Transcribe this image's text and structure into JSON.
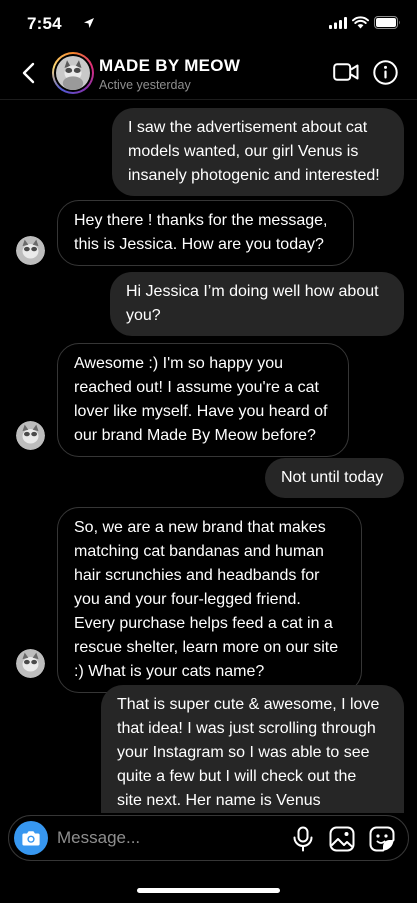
{
  "status_bar": {
    "time": "7:54"
  },
  "header": {
    "name": "MADE BY MEOW",
    "status": "Active yesterday"
  },
  "messages": [
    {
      "side": "sent",
      "lines": [
        "I saw the advertisement about cat",
        "models wanted, our girl Venus is",
        "insanely photogenic and interested!"
      ]
    },
    {
      "side": "received",
      "lines": [
        "Hey there ! thanks for the message,",
        "this is Jessica. How are you today?"
      ]
    },
    {
      "side": "sent",
      "lines": [
        "Hi Jessica I’m doing well how about",
        "you?"
      ]
    },
    {
      "side": "received",
      "lines": [
        "Awesome :) I'm so happy you",
        "reached out! I assume you're a cat",
        "lover like myself. Have you heard of",
        "our brand Made By Meow before?"
      ]
    },
    {
      "side": "sent",
      "lines": [
        "Not until today"
      ]
    },
    {
      "side": "received",
      "lines": [
        "So, we are a new brand that makes",
        "matching cat bandanas and human",
        "hair scrunchies and headbands for",
        "you and your four-legged friend.",
        "Every purchase helps feed a cat in a",
        "rescue shelter, learn more on our site",
        ":) What is your cats name?"
      ]
    },
    {
      "side": "sent",
      "lines": [
        "That is super cute & awesome, I love",
        "that idea! I was just scrolling through",
        "your Instagram so I was able to see",
        "quite a few but I will check out the",
        "site next. Her name is Venus"
      ]
    }
  ],
  "composer": {
    "placeholder": "Message..."
  },
  "colors": {
    "background": "#000000",
    "sent_bubble": "#262626",
    "received_border": "#363636",
    "accent_blue": "#3797f0",
    "muted_text": "#8e8e8e"
  },
  "icons": [
    "location-arrow-icon",
    "signal-icon",
    "wifi-icon",
    "battery-icon",
    "back-chevron-icon",
    "video-camera-icon",
    "info-icon",
    "camera-icon",
    "microphone-icon",
    "gallery-icon",
    "sticker-icon"
  ]
}
